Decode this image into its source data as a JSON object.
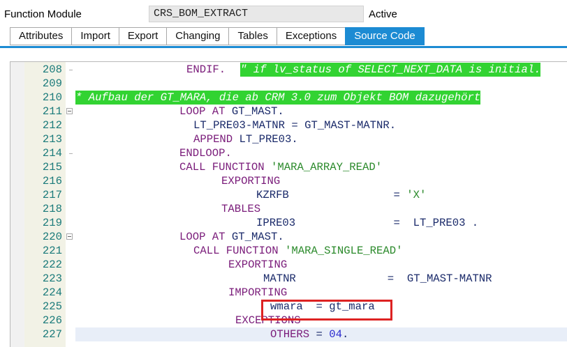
{
  "header": {
    "field_label": "Function Module",
    "function_name": "CRS_BOM_EXTRACT",
    "status": "Active"
  },
  "tabs": [
    {
      "label": "Attributes",
      "active": false
    },
    {
      "label": "Import",
      "active": false
    },
    {
      "label": "Export",
      "active": false
    },
    {
      "label": "Changing",
      "active": false
    },
    {
      "label": "Tables",
      "active": false
    },
    {
      "label": "Exceptions",
      "active": false
    },
    {
      "label": "Source Code",
      "active": true
    }
  ],
  "editor": {
    "lines": [
      {
        "n": "208",
        "fold": "dash",
        "tokens": [
          {
            "t": "kw",
            "v": "ENDIF."
          }
        ],
        "comment": "\" if lv_status of SELECT_NEXT_DATA is initial."
      },
      {
        "n": "209",
        "fold": "",
        "tokens": []
      },
      {
        "n": "210",
        "fold": "",
        "tokens": [],
        "comment": "* Aufbau der GT_MARA, die ab CRM 3.0 zum Objekt BOM dazugehört"
      },
      {
        "n": "211",
        "fold": "box",
        "tokens": [
          {
            "t": "kw",
            "v": "LOOP AT"
          },
          {
            "t": "plain",
            "v": " GT_MAST."
          }
        ]
      },
      {
        "n": "212",
        "fold": "",
        "tokens": [
          {
            "t": "plain",
            "v": "LT_PRE03-MATNR = GT_MAST-MATNR."
          }
        ]
      },
      {
        "n": "213",
        "fold": "",
        "tokens": [
          {
            "t": "kw",
            "v": "APPEND"
          },
          {
            "t": "plain",
            "v": " LT_PRE03."
          }
        ]
      },
      {
        "n": "214",
        "fold": "dash",
        "tokens": [
          {
            "t": "kw",
            "v": "ENDLOOP."
          }
        ]
      },
      {
        "n": "215",
        "fold": "",
        "tokens": [
          {
            "t": "kw",
            "v": "CALL FUNCTION"
          },
          {
            "t": "plain",
            "v": " "
          },
          {
            "t": "str",
            "v": "'MARA_ARRAY_READ'"
          }
        ]
      },
      {
        "n": "216",
        "fold": "",
        "tokens": [
          {
            "t": "kw",
            "v": "EXPORTING"
          }
        ]
      },
      {
        "n": "217",
        "fold": "",
        "tokens": [
          {
            "t": "plain",
            "v": "KZRFB                = "
          },
          {
            "t": "str",
            "v": "'X'"
          }
        ]
      },
      {
        "n": "218",
        "fold": "",
        "tokens": [
          {
            "t": "kw",
            "v": "TABLES"
          }
        ]
      },
      {
        "n": "219",
        "fold": "",
        "tokens": [
          {
            "t": "plain",
            "v": "IPRE03               =  LT_PRE03 ."
          }
        ]
      },
      {
        "n": "220",
        "fold": "box",
        "tokens": [
          {
            "t": "kw",
            "v": "LOOP AT"
          },
          {
            "t": "plain",
            "v": " GT_MAST."
          }
        ]
      },
      {
        "n": "221",
        "fold": "",
        "tokens": [
          {
            "t": "kw",
            "v": "CALL FUNCTION"
          },
          {
            "t": "plain",
            "v": " "
          },
          {
            "t": "str",
            "v": "'MARA_SINGLE_READ'"
          }
        ]
      },
      {
        "n": "222",
        "fold": "",
        "tokens": [
          {
            "t": "kw",
            "v": "EXPORTING"
          }
        ]
      },
      {
        "n": "223",
        "fold": "",
        "tokens": [
          {
            "t": "plain",
            "v": "MATNR              =  GT_MAST-MATNR"
          }
        ]
      },
      {
        "n": "224",
        "fold": "",
        "tokens": [
          {
            "t": "kw",
            "v": "IMPORTING"
          }
        ]
      },
      {
        "n": "225",
        "fold": "",
        "tokens": [
          {
            "t": "plain",
            "v": "wmara  = gt_mara"
          }
        ]
      },
      {
        "n": "226",
        "fold": "",
        "tokens": [
          {
            "t": "kw",
            "v": "EXCEPTIONS"
          }
        ]
      },
      {
        "n": "227",
        "fold": "",
        "tokens": [
          {
            "t": "kw",
            "v": "OTHERS"
          },
          {
            "t": "plain",
            "v": " = "
          },
          {
            "t": "num",
            "v": "04"
          },
          {
            "t": "plain",
            "v": "."
          }
        ]
      }
    ]
  }
}
